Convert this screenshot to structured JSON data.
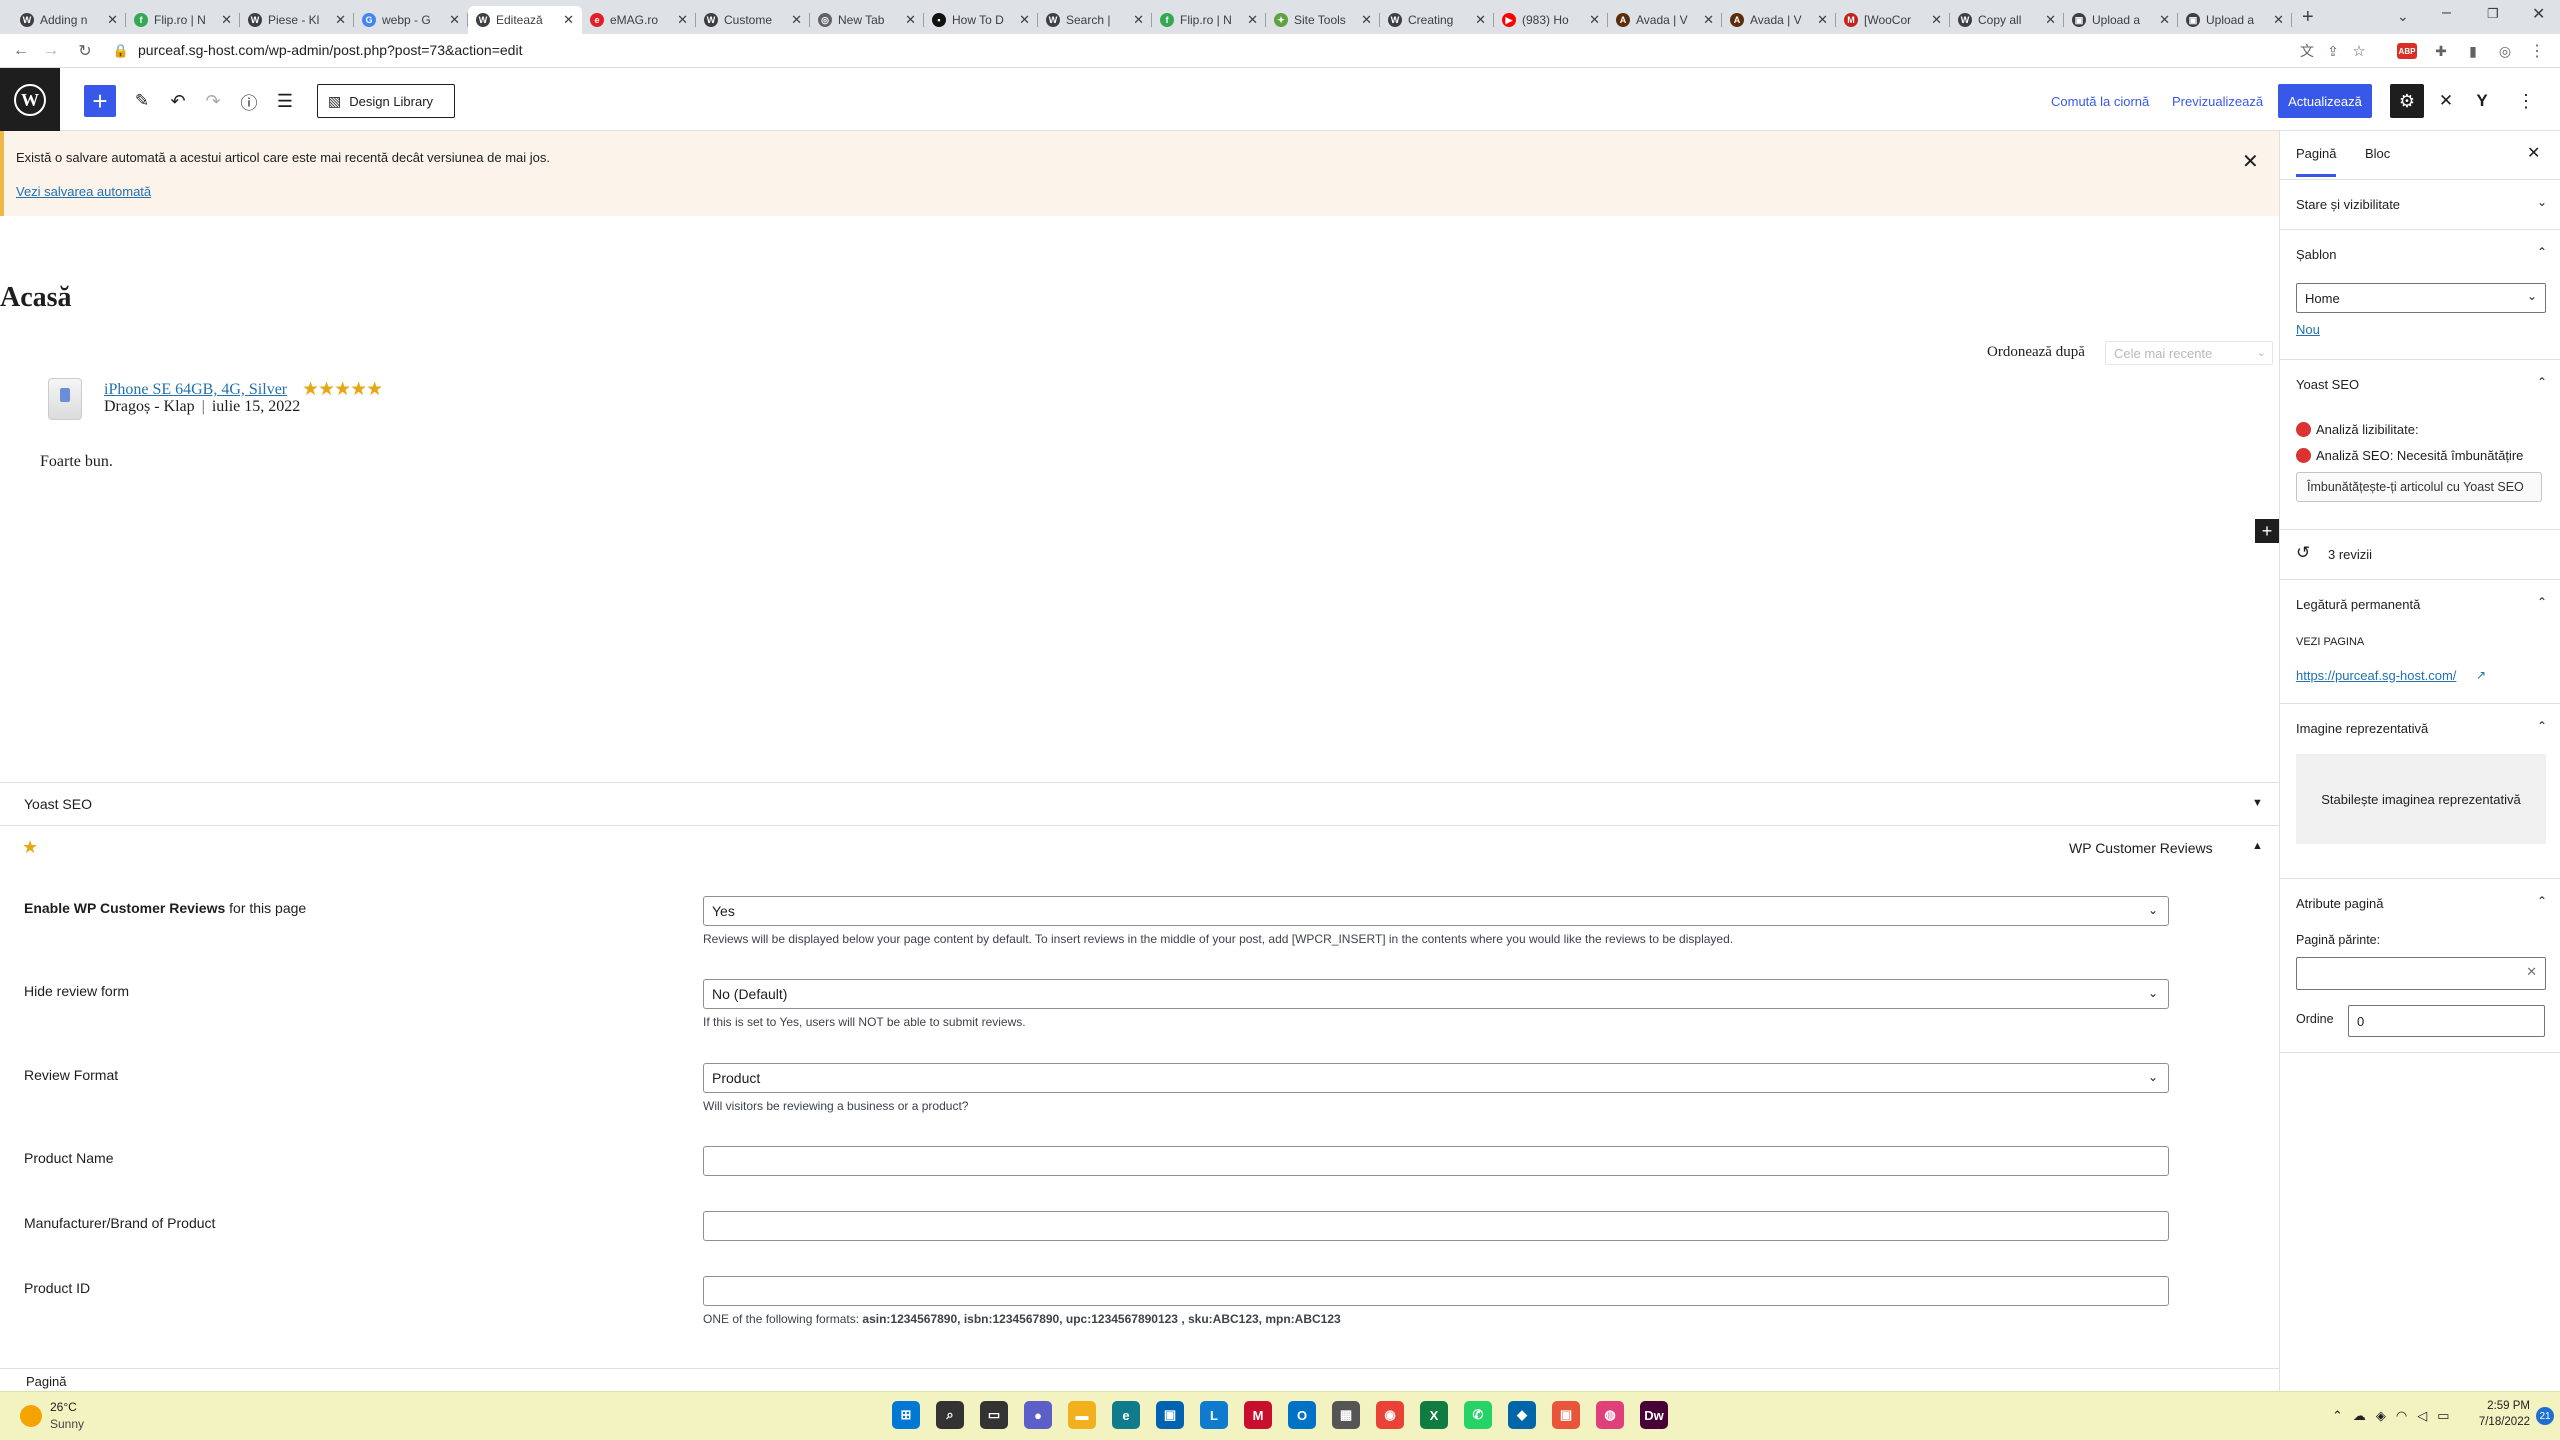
{
  "browser": {
    "tabs": [
      {
        "label": "Adding n",
        "color": "#3c4043",
        "glyph": "W"
      },
      {
        "label": "Flip.ro | N",
        "color": "#34a853",
        "glyph": "f"
      },
      {
        "label": "Piese - Kl",
        "color": "#3c4043",
        "glyph": "W"
      },
      {
        "label": "webp - G",
        "color": "#4285f4",
        "glyph": "G"
      },
      {
        "label": "Editează",
        "color": "#3c4043",
        "glyph": "W"
      },
      {
        "label": "eMAG.ro",
        "color": "#e41e26",
        "glyph": "e"
      },
      {
        "label": "Custome",
        "color": "#3c4043",
        "glyph": "W"
      },
      {
        "label": "New Tab",
        "color": "#5f6368",
        "glyph": "◎"
      },
      {
        "label": "How To D",
        "color": "#111111",
        "glyph": "▪"
      },
      {
        "label": "Search |",
        "color": "#3c4043",
        "glyph": "W"
      },
      {
        "label": "Flip.ro | N",
        "color": "#34a853",
        "glyph": "f"
      },
      {
        "label": "Site Tools",
        "color": "#5fa340",
        "glyph": "✦"
      },
      {
        "label": "Creating",
        "color": "#3c4043",
        "glyph": "W"
      },
      {
        "label": "(983) Ho",
        "color": "#ff0000",
        "glyph": "▶"
      },
      {
        "label": "Avada | V",
        "color": "#5a2d0c",
        "glyph": "A"
      },
      {
        "label": "Avada | V",
        "color": "#5a2d0c",
        "glyph": "A"
      },
      {
        "label": "[WooCor",
        "color": "#c5221f",
        "glyph": "M"
      },
      {
        "label": "Copy all",
        "color": "#3c4043",
        "glyph": "W"
      },
      {
        "label": "Upload a",
        "color": "#3c4043",
        "glyph": "▣"
      },
      {
        "label": "Upload a",
        "color": "#3c4043",
        "glyph": "▣"
      }
    ],
    "active_tab_index": 4,
    "url": "purceaf.sg-host.com/wp-admin/post.php?post=73&action=edit",
    "new_tab": "+",
    "ext_abp": "ABP"
  },
  "wp_header": {
    "design_library": "Design Library",
    "switch_draft": "Comută la ciornă",
    "preview": "Previzualizează",
    "update": "Actualizează"
  },
  "notice": {
    "message": "Există o salvare automată a acestui articol care este mai recentă decât versiunea de mai jos.",
    "link": "Vezi salvarea automată"
  },
  "page": {
    "title": "Acasă",
    "sort_label": "Ordonează după",
    "sort_value": "Cele mai recente",
    "review": {
      "product": "iPhone SE 64GB, 4G, Silver",
      "stars": "★★★★★",
      "author": "Dragoș - Klap",
      "date": "iulie 15, 2022",
      "text": "Foarte bun."
    }
  },
  "metaboxes": {
    "yoast_title": "Yoast SEO",
    "wpcr_title": "WP Customer Reviews",
    "fields": {
      "enable_label_bold": "Enable WP Customer Reviews",
      "enable_label_rest": " for this page",
      "enable_value": "Yes",
      "enable_help": "Reviews will be displayed below your page content by default. To insert reviews in the middle of your post, add [WPCR_INSERT] in the contents where you would like the reviews to be displayed.",
      "hide_label": "Hide review form",
      "hide_value": "No (Default)",
      "hide_help": "If this is set to Yes, users will NOT be able to submit reviews.",
      "format_label": "Review Format",
      "format_value": "Product",
      "format_help": "Will visitors be reviewing a business or a product?",
      "product_name_label": "Product Name",
      "brand_label": "Manufacturer/Brand of Product",
      "product_id_label": "Product ID",
      "product_id_help_prefix": "ONE of the following formats: ",
      "product_id_formats": "asin:1234567890, isbn:1234567890, upc:1234567890123 , sku:ABC123, mpn:ABC123"
    }
  },
  "footer_breadcrumb": "Pagină",
  "sidebar": {
    "tab_page": "Pagină",
    "tab_block": "Bloc",
    "status_visibility": "Stare și vizibilitate",
    "template_title": "Șablon",
    "template_value": "Home",
    "template_new": "Nou",
    "yoast_title": "Yoast SEO",
    "readability": "Analiză lizibilitate:",
    "seo_analysis": "Analiză SEO: Necesită îmbunătățire",
    "yoast_button": "Îmbunătățește-ți articolul cu Yoast SEO",
    "revisions": "3 revizii",
    "permalink_title": "Legătură permanentă",
    "view_page": "VEZI PAGINA",
    "permalink_url": "https://purceaf.sg-host.com/",
    "featured_title": "Imagine reprezentativă",
    "featured_button": "Stabilește imaginea reprezentativă",
    "attributes_title": "Atribute pagină",
    "parent_label": "Pagină părinte:",
    "order_label": "Ordine",
    "order_value": "0"
  },
  "taskbar": {
    "weather_temp": "26°C",
    "weather_desc": "Sunny",
    "time": "2:59 PM",
    "date": "7/18/2022",
    "notif_count": "21",
    "app_colors": [
      "#0078d4",
      "#333333",
      "#333333",
      "#5b5fc7",
      "#f2b01e",
      "#0f7b8c",
      "#0063b1",
      "#0f7bcf",
      "#c8102e",
      "#0072c6",
      "#555555",
      "#ea4335",
      "#107c41",
      "#25d366",
      "#0065a9",
      "#e8553a",
      "#e0407a",
      "#470137"
    ],
    "app_glyphs": [
      "⊞",
      "⌕",
      "▭",
      "●",
      "▬",
      "e",
      "▣",
      "L",
      "M",
      "O",
      "▦",
      "◉",
      "X",
      "✆",
      "◆",
      "▣",
      "◍",
      "Dw"
    ]
  }
}
